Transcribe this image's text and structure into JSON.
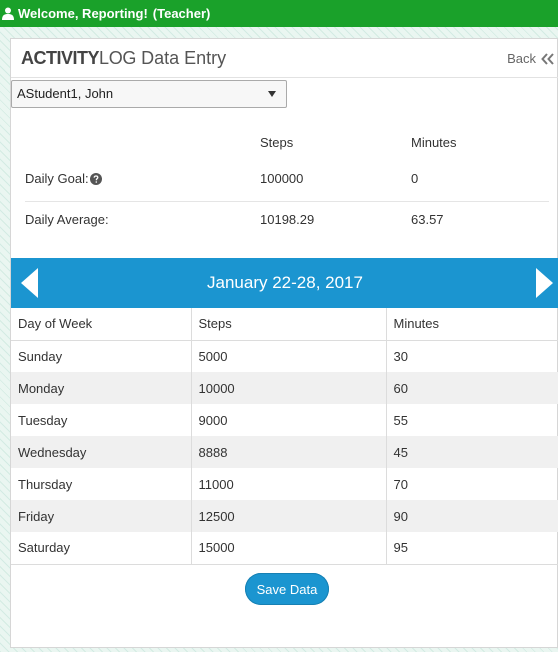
{
  "topbar": {
    "welcome": "Welcome, Reporting!",
    "role": "(Teacher)"
  },
  "header": {
    "brand_bold": "ACTIVITY",
    "brand_light": "LOG",
    "title": "Data Entry",
    "back_label": "Back"
  },
  "student_select": {
    "selected": "AStudent1, John"
  },
  "goals": {
    "col_steps": "Steps",
    "col_minutes": "Minutes",
    "daily_goal": {
      "label": "Daily Goal:",
      "steps": "100000",
      "minutes": "0"
    },
    "daily_average": {
      "label": "Daily Average:",
      "steps": "10198.29",
      "minutes": "63.57"
    }
  },
  "week": {
    "range": "January 22-28, 2017"
  },
  "table": {
    "headers": [
      "Day of Week",
      "Steps",
      "Minutes"
    ],
    "rows": [
      [
        "Sunday",
        "5000",
        "30"
      ],
      [
        "Monday",
        "10000",
        "60"
      ],
      [
        "Tuesday",
        "9000",
        "55"
      ],
      [
        "Wednesday",
        "8888",
        "45"
      ],
      [
        "Thursday",
        "11000",
        "70"
      ],
      [
        "Friday",
        "12500",
        "90"
      ],
      [
        "Saturday",
        "15000",
        "95"
      ]
    ]
  },
  "save_label": "Save Data",
  "colors": {
    "topbar": "#1aa12a",
    "accent": "#1b95d0"
  }
}
